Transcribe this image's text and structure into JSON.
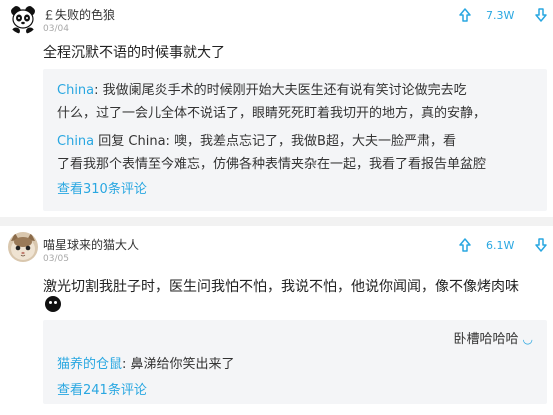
{
  "posts": [
    {
      "username": "￡失败的色狼",
      "date": "03/04",
      "score": "7.3W",
      "text": "全程沉默不语的时候事就大了",
      "replies": [
        {
          "name": "China",
          "lines": [
            ": 我做阑尾炎手术的时候刚开始大夫医生还有说有笑讨论做完去吃",
            "什么，过了一会儿全体不说话了，眼睛死死盯着我切开的地方，真的安静，"
          ]
        },
        {
          "name": "China",
          "lines": [
            " 回复 China: 噢，我差点忘记了，我做B超，大夫一脸严肃，看",
            "了看我那个表情至今难忘，仿佛各种表情夹杂在一起，我看了看报告单盆腔"
          ]
        }
      ],
      "more": "查看310条评论"
    },
    {
      "username": "喵星球来的猫大人",
      "date": "03/05",
      "score": "6.1W",
      "text": "激光切割我肚子时，医生问我怕不怕，我说不怕，他说你闻闻，像不像烤肉味",
      "top_reply": "卧槽哈哈哈",
      "replies": [
        {
          "name": "猫养的仓鼠",
          "lines": [
            ": 鼻涕给你笑出来了"
          ]
        }
      ],
      "more": "查看241条评论"
    }
  ],
  "icons": {
    "vote_up": "thumb-up-icon",
    "vote_down": "thumb-down-icon",
    "comment": "comment-bubble-icon"
  },
  "colors": {
    "accent": "#29a7e1",
    "date": "#a8a8a8",
    "reply_bg": "#f4f5f7"
  }
}
